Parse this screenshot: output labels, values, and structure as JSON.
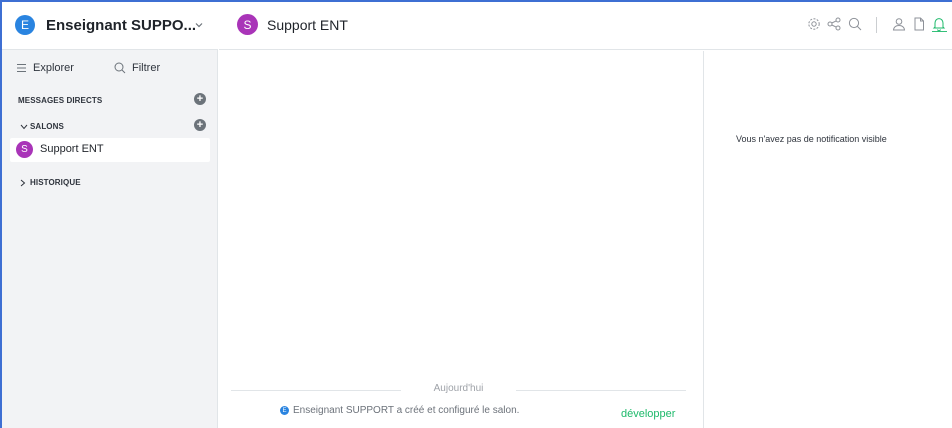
{
  "workspace": {
    "avatar_letter": "E",
    "name": "Enseignant SUPPO...",
    "avatar_color": "#2a84e0"
  },
  "sidebar": {
    "explorer_label": "Explorer",
    "filter_label": "Filtrer",
    "sections": {
      "direct_messages": "MESSAGES DIRECTS",
      "rooms": "SALONS",
      "history": "HISTORIQUE"
    },
    "rooms": [
      {
        "avatar_letter": "S",
        "label": "Support ENT",
        "color": "#a934b8"
      }
    ]
  },
  "header": {
    "avatar_letter": "S",
    "title": "Support ENT",
    "icons": [
      "gear-icon",
      "share-icon",
      "search-icon",
      "user-icon",
      "file-icon",
      "bell-icon"
    ]
  },
  "chat": {
    "day_divider": "Aujourd'hui",
    "system_message": {
      "avatar_letter": "E",
      "text": "Enseignant SUPPORT a créé et configuré le salon."
    },
    "expand_label": "développer"
  },
  "notifications": {
    "empty_text": "Vous n'avez pas de notification visible"
  },
  "colors": {
    "accent_blue": "#2a84e0",
    "room_purple": "#a934b8",
    "link_green": "#1db96a",
    "active_bell": "#1db96a"
  }
}
